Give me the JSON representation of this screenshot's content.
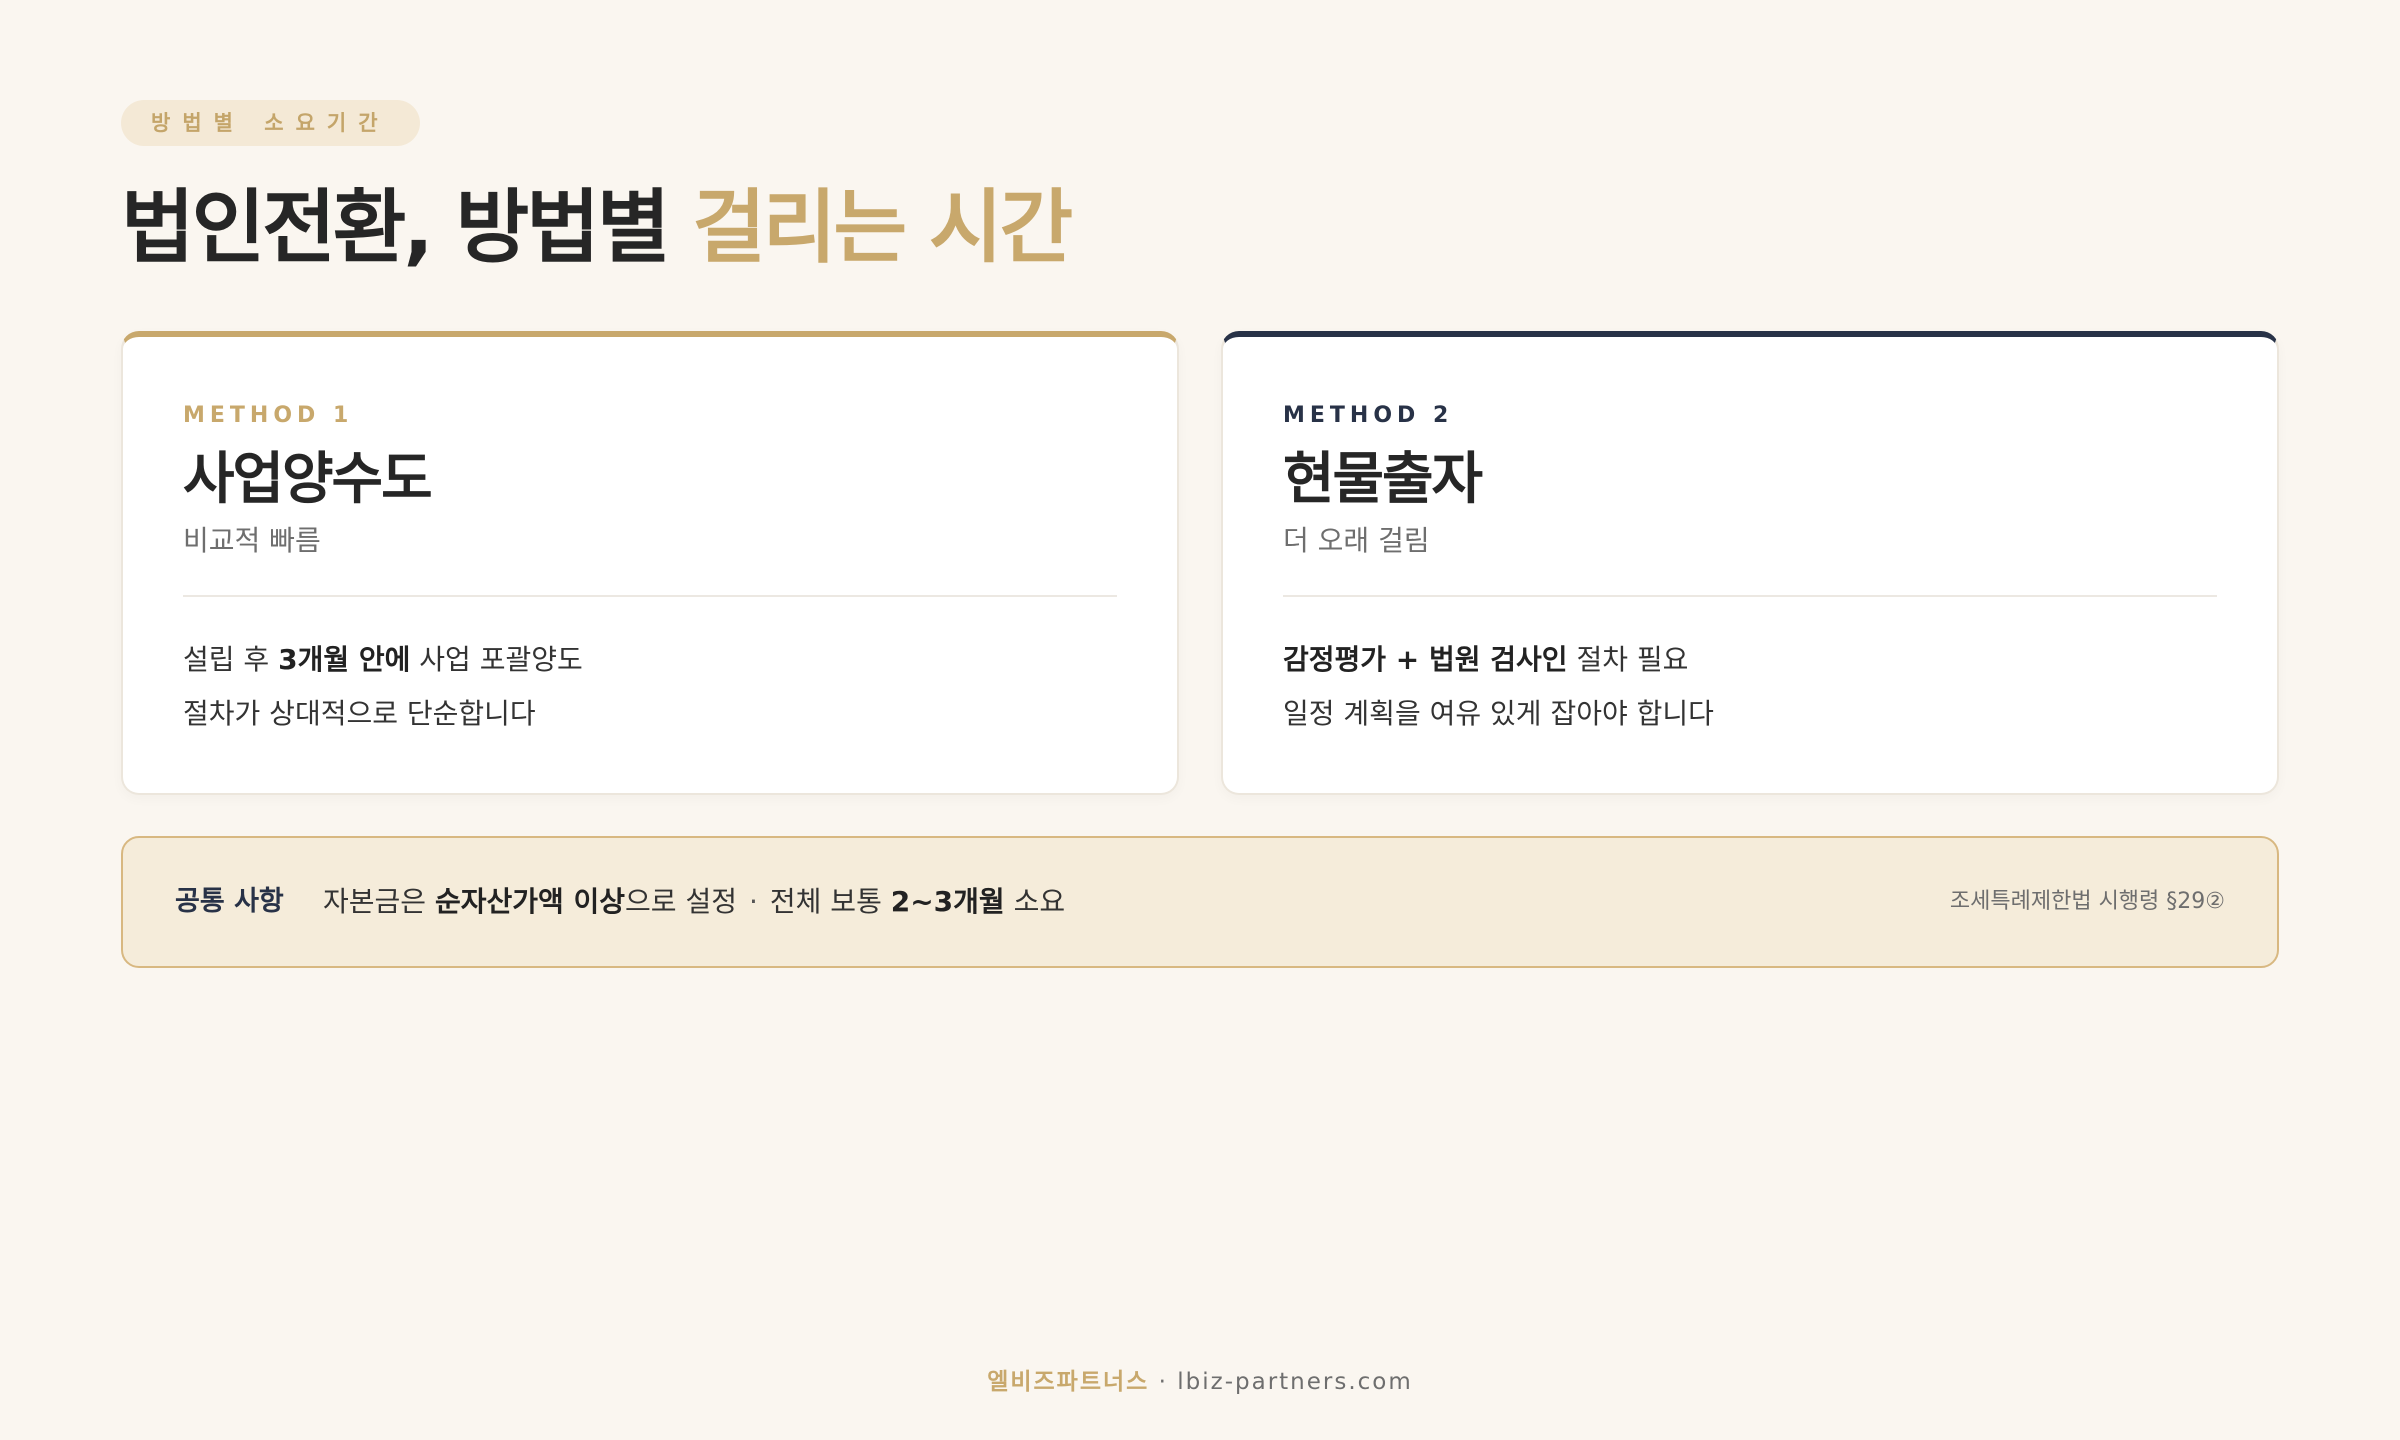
{
  "tag": "방법별 소요기간",
  "title": {
    "main": "법인전환, 방법별 ",
    "accent": "걸리는 시간"
  },
  "methods": [
    {
      "label": "METHOD 1",
      "name": "사업양수도",
      "subtitle": "비교적 빠름",
      "line1": {
        "pre": "설립 후 ",
        "bold": "3개월 안에",
        "post": " 사업 포괄양도"
      },
      "line2": "절차가 상대적으로 단순합니다"
    },
    {
      "label": "METHOD 2",
      "name": "현물출자",
      "subtitle": "더 오래 걸림",
      "line1": {
        "pre": "",
        "bold": "감정평가 + 법원 검사인",
        "post": " 절차 필요"
      },
      "line2": "일정 계획을 여유 있게 잡아야 합니다"
    }
  ],
  "common": {
    "label": "공통 사항",
    "part1": "자본금은 ",
    "bold1": "순자산가액 이상",
    "part2": "으로 설정",
    "separator": "·",
    "part3": "전체 보통 ",
    "bold2": "2~3개월",
    "part4": " 소요",
    "reference": "조세특례제한법 시행령 §29②"
  },
  "footer": {
    "brand": "엘비즈파트너스",
    "separator": " · ",
    "domain": "lbiz-partners.com"
  },
  "colors": {
    "accent_gold": "#c8a86c",
    "accent_navy": "#283247",
    "background": "#faf6f0",
    "common_bg": "#f5ecda"
  }
}
